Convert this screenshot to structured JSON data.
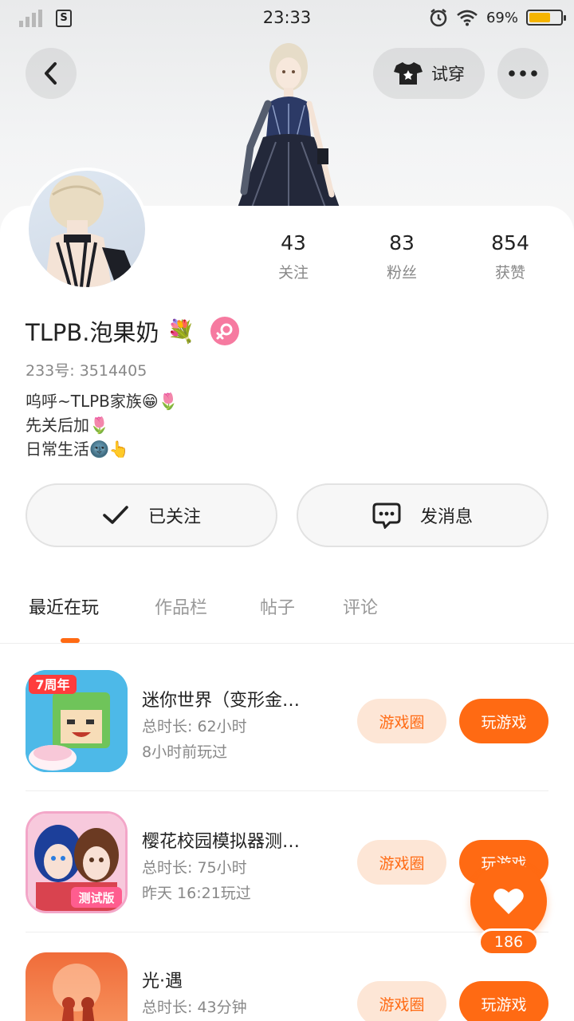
{
  "status_bar": {
    "time": "23:33",
    "sim_label": "S",
    "battery_percent": "69%",
    "battery_level": 0.69
  },
  "header": {
    "try_on_label": "试穿"
  },
  "stats": [
    {
      "value": "43",
      "label": "关注"
    },
    {
      "value": "83",
      "label": "粉丝"
    },
    {
      "value": "854",
      "label": "获赞"
    }
  ],
  "profile": {
    "name": "TLPB.泡果奶",
    "name_emoji": "💐",
    "uid": "233号: 3514405",
    "bio": [
      "呜呼~TLPB家族😁🌷",
      "先关后加🌷",
      "日常生活🌚👆"
    ]
  },
  "actions": {
    "followed_label": "已关注",
    "message_label": "发消息"
  },
  "tabs": [
    {
      "label": "最近在玩",
      "active": true
    },
    {
      "label": "作品栏",
      "active": false
    },
    {
      "label": "帖子",
      "active": false
    },
    {
      "label": "评论",
      "active": false
    }
  ],
  "games": [
    {
      "title": "迷你世界（变形金…",
      "duration": "总时长: 62小时",
      "last_played": "8小时前玩过",
      "icon_badge": "7周年",
      "circle_label": "游戏圈",
      "play_label": "玩游戏"
    },
    {
      "title": "樱花校园模拟器测…",
      "duration": "总时长: 75小时",
      "last_played": "昨天 16:21玩过",
      "icon_badge": "测试版",
      "circle_label": "游戏圈",
      "play_label": "玩游戏"
    },
    {
      "title": "光·遇",
      "duration": "总时长: 43分钟",
      "last_played": "",
      "icon_badge": "",
      "circle_label": "游戏圈",
      "play_label": "玩游戏"
    }
  ],
  "like_fab": {
    "count": "186"
  },
  "colors": {
    "accent": "#ff6a13",
    "accent_soft": "#fde6d6",
    "gender": "#f67aa0"
  }
}
